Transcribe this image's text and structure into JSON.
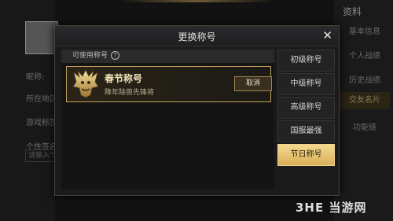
{
  "background": {
    "left_labels": [
      "昵称:",
      "所在地区",
      "游戏标签",
      "个性签名"
    ],
    "input_placeholder": "请输入个",
    "right_title": "资料",
    "right_items": [
      "基本信息",
      "个人战绩",
      "历史战绩",
      "交友名片",
      "功能链"
    ],
    "right_active": 3
  },
  "dialog": {
    "title": "更换称号",
    "close_icon": "close-icon",
    "available_label": "可使用称号",
    "help_icon": "question-circle-icon",
    "card": {
      "name": "春节称号",
      "description": "降年除兽先锋将",
      "action": "取消",
      "emblem_icon": "golden-beast-emblem"
    },
    "tabs": [
      "初级称号",
      "中级称号",
      "高级称号",
      "国服最强",
      "节日称号"
    ],
    "active_tab": 4
  },
  "watermark": "3HE 当游网",
  "colors": {
    "accent_gold": "#d9b05a",
    "card_border": "#c0a05c",
    "bg": "#121212"
  }
}
